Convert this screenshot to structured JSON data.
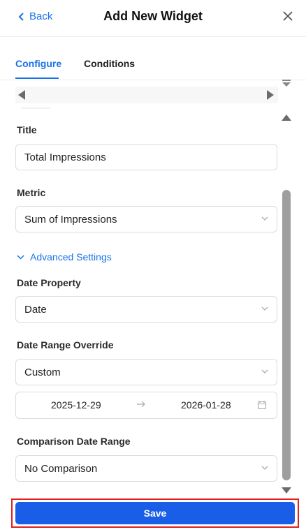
{
  "header": {
    "back_label": "Back",
    "title": "Add New Widget"
  },
  "tabs": [
    {
      "label": "Configure"
    },
    {
      "label": "Conditions"
    }
  ],
  "form": {
    "title_label": "Title",
    "title_value": "Total Impressions",
    "metric_label": "Metric",
    "metric_value": "Sum of Impressions",
    "advanced_label": "Advanced Settings",
    "date_property_label": "Date Property",
    "date_property_value": "Date",
    "date_range_override_label": "Date Range Override",
    "date_range_override_value": "Custom",
    "date_start": "2025-12-29",
    "date_end": "2026-01-28",
    "comparison_label": "Comparison Date Range",
    "comparison_value": "No Comparison"
  },
  "footer": {
    "save_label": "Save"
  },
  "colors": {
    "accent": "#1a73e8",
    "save_button": "#1a5ee8",
    "highlight_border": "#e02020"
  }
}
